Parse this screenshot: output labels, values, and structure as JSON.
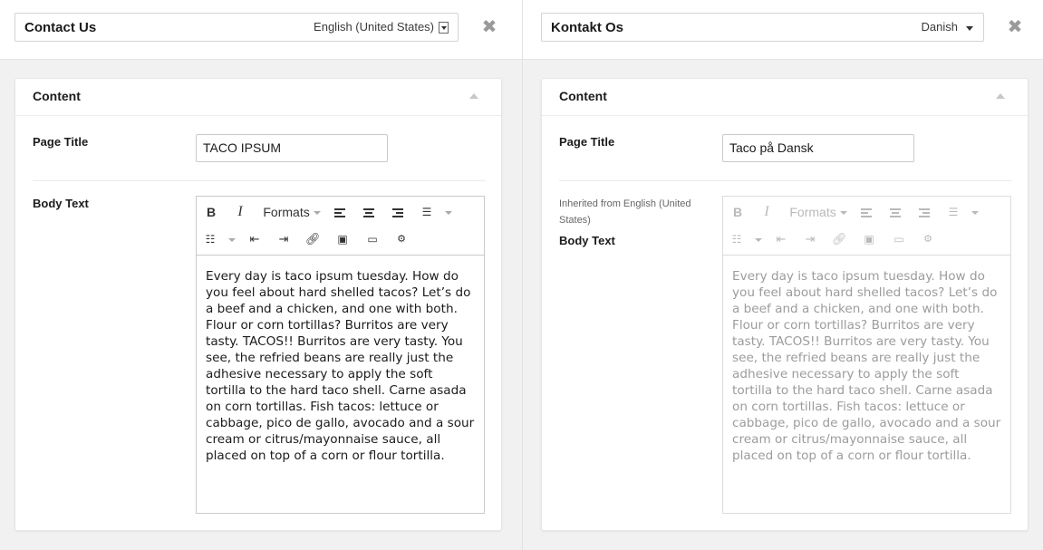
{
  "left": {
    "title": "Contact Us",
    "language": "English (United States)",
    "card_title": "Content",
    "page_title_label": "Page Title",
    "page_title_value": "TACO IPSUM",
    "body_text_label": "Body Text",
    "toolbar": {
      "formats_label": "Formats"
    },
    "body_text": "Every day is taco ipsum tuesday. How do you feel about hard shelled tacos? Let’s do a beef and a chicken, and one with both. Flour or corn tortillas? Burritos are very tasty. TACOS!! Burritos are very tasty. You see, the refried beans are really just the adhesive necessary to apply the soft tortilla to the hard taco shell. Carne asada on corn tortillas. Fish tacos: lettuce or cabbage, pico de gallo, avocado and a sour cream or citrus/mayonnaise sauce, all placed on top of a corn or flour tortilla."
  },
  "right": {
    "title": "Kontakt Os",
    "language": "Danish",
    "card_title": "Content",
    "page_title_label": "Page Title",
    "page_title_value": "Taco på Dansk",
    "inherited_note": "Inherited from English (United States)",
    "body_text_label": "Body Text",
    "toolbar": {
      "formats_label": "Formats"
    },
    "body_text": "Every day is taco ipsum tuesday. How do you feel about hard shelled tacos? Let’s do a beef and a chicken, and one with both. Flour or corn tortillas? Burritos are very tasty. TACOS!! Burritos are very tasty. You see, the refried beans are really just the adhesive necessary to apply the soft tortilla to the hard taco shell. Carne asada on corn tortillas. Fish tacos: lettuce or cabbage, pico de gallo, avocado and a sour cream or citrus/mayonnaise sauce, all placed on top of a corn or flour tortilla."
  },
  "icons": [
    "bold-icon",
    "italic-icon",
    "align-left-icon",
    "align-center-icon",
    "align-right-icon",
    "bullet-list-icon",
    "numbered-list-icon",
    "outdent-icon",
    "indent-icon",
    "link-icon",
    "image-icon",
    "media-icon",
    "settings-icon",
    "close-icon",
    "collapse-icon"
  ],
  "colors": {
    "background": "#f1f1f1",
    "card": "#ffffff",
    "border": "#c9c9c9",
    "disabled_text": "#9c9c9c"
  }
}
